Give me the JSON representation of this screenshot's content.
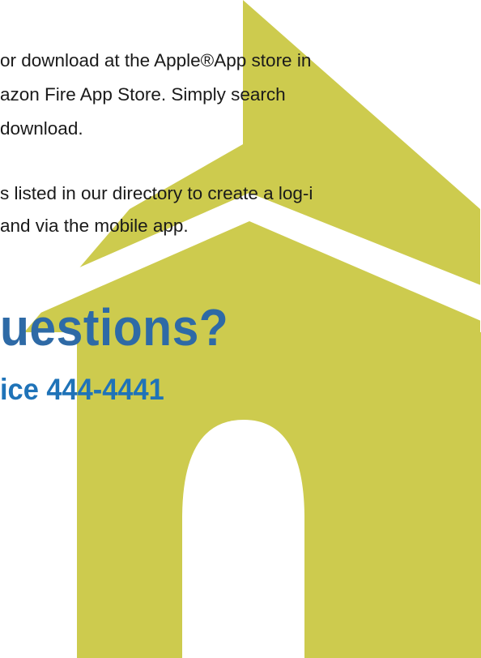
{
  "colors": {
    "church_fill": "#CDCB4E",
    "heading_blue": "#2E6AA6",
    "office_blue": "#1F73B8",
    "body_text": "#1a1a1a"
  },
  "paragraph1": {
    "lines": [
      "or download at the Apple®App store in",
      "azon Fire App Store. Simply search",
      " download."
    ]
  },
  "paragraph2": {
    "lines": [
      "s listed in our directory to create a log-i",
      "and via the  mobile app."
    ]
  },
  "questions_heading": "uestions?",
  "office_line": "ice 444-4441",
  "graphic": {
    "icon": "church-building-icon"
  }
}
